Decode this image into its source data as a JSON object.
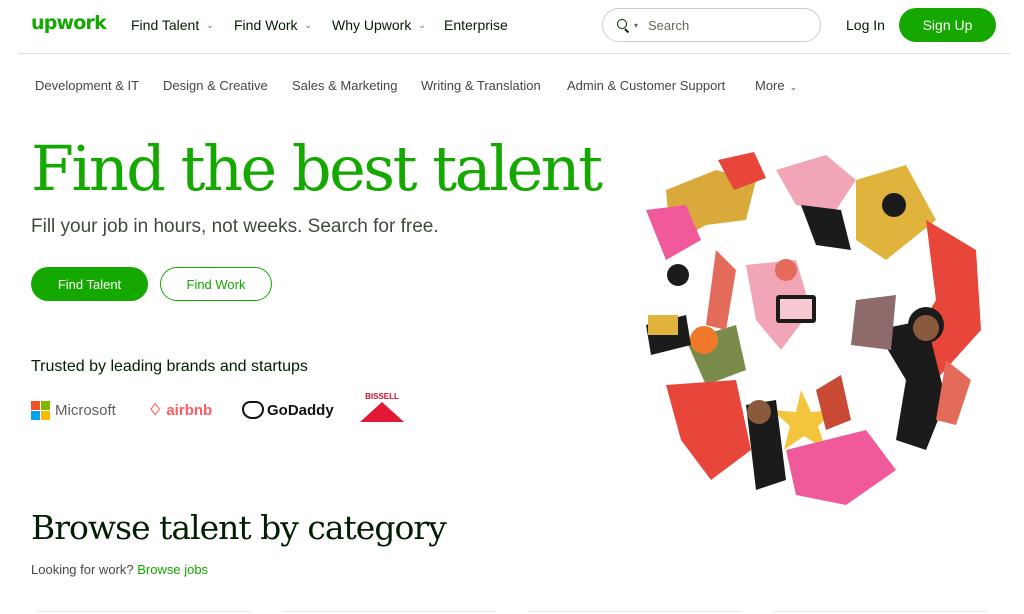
{
  "brand": {
    "logo_text": "upwork",
    "accent": "#14a800"
  },
  "header": {
    "nav": [
      {
        "label": "Find Talent",
        "has_dropdown": true
      },
      {
        "label": "Find Work",
        "has_dropdown": true
      },
      {
        "label": "Why Upwork",
        "has_dropdown": true
      },
      {
        "label": "Enterprise",
        "has_dropdown": false
      }
    ],
    "search": {
      "placeholder": "Search"
    },
    "login_label": "Log In",
    "signup_label": "Sign Up"
  },
  "categories": {
    "items": [
      "Development & IT",
      "Design & Creative",
      "Sales & Marketing",
      "Writing & Translation",
      "Admin & Customer Support"
    ],
    "more_label": "More"
  },
  "hero": {
    "title": "Find the best talent",
    "subtitle": "Fill your job in hours, not weeks. Search for free.",
    "primary_cta": "Find Talent",
    "secondary_cta": "Find Work",
    "trusted_label": "Trusted by leading brands and startups",
    "brands": [
      "Microsoft",
      "airbnb",
      "GoDaddy",
      "BISSELL"
    ],
    "illustration_icon": "people-collage-illustration"
  },
  "browse": {
    "title": "Browse talent by category",
    "prompt": "Looking for work?",
    "link": "Browse jobs"
  }
}
